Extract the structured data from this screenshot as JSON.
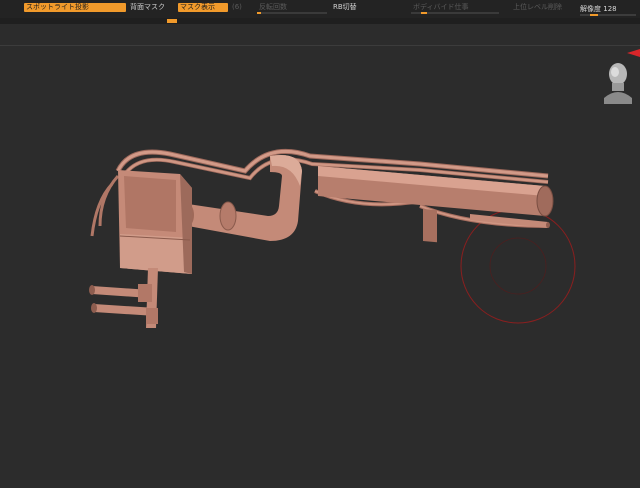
{
  "toolbar": {
    "spotlight_label": "スポットライト投影",
    "backface_mask_label": "背面マスク",
    "show_mask_label": "マスク表示",
    "dim_hint": "(6)",
    "dim_slider_label": "反転回数",
    "rb_toggle_label": "RB切替",
    "subdivide_label": "ボディバイド仕事",
    "delete_higher_label": "上位レベル削除",
    "resolution_label": "解像度",
    "resolution_value": "128"
  },
  "colors": {
    "accent": "#f19a2b",
    "model": "#c98f7d",
    "brush_ring": "#8a1f1f",
    "background": "#2c2c2c"
  },
  "icons": {
    "orientation_head": "head-icon",
    "red_indicator": "red-arrow-icon"
  }
}
